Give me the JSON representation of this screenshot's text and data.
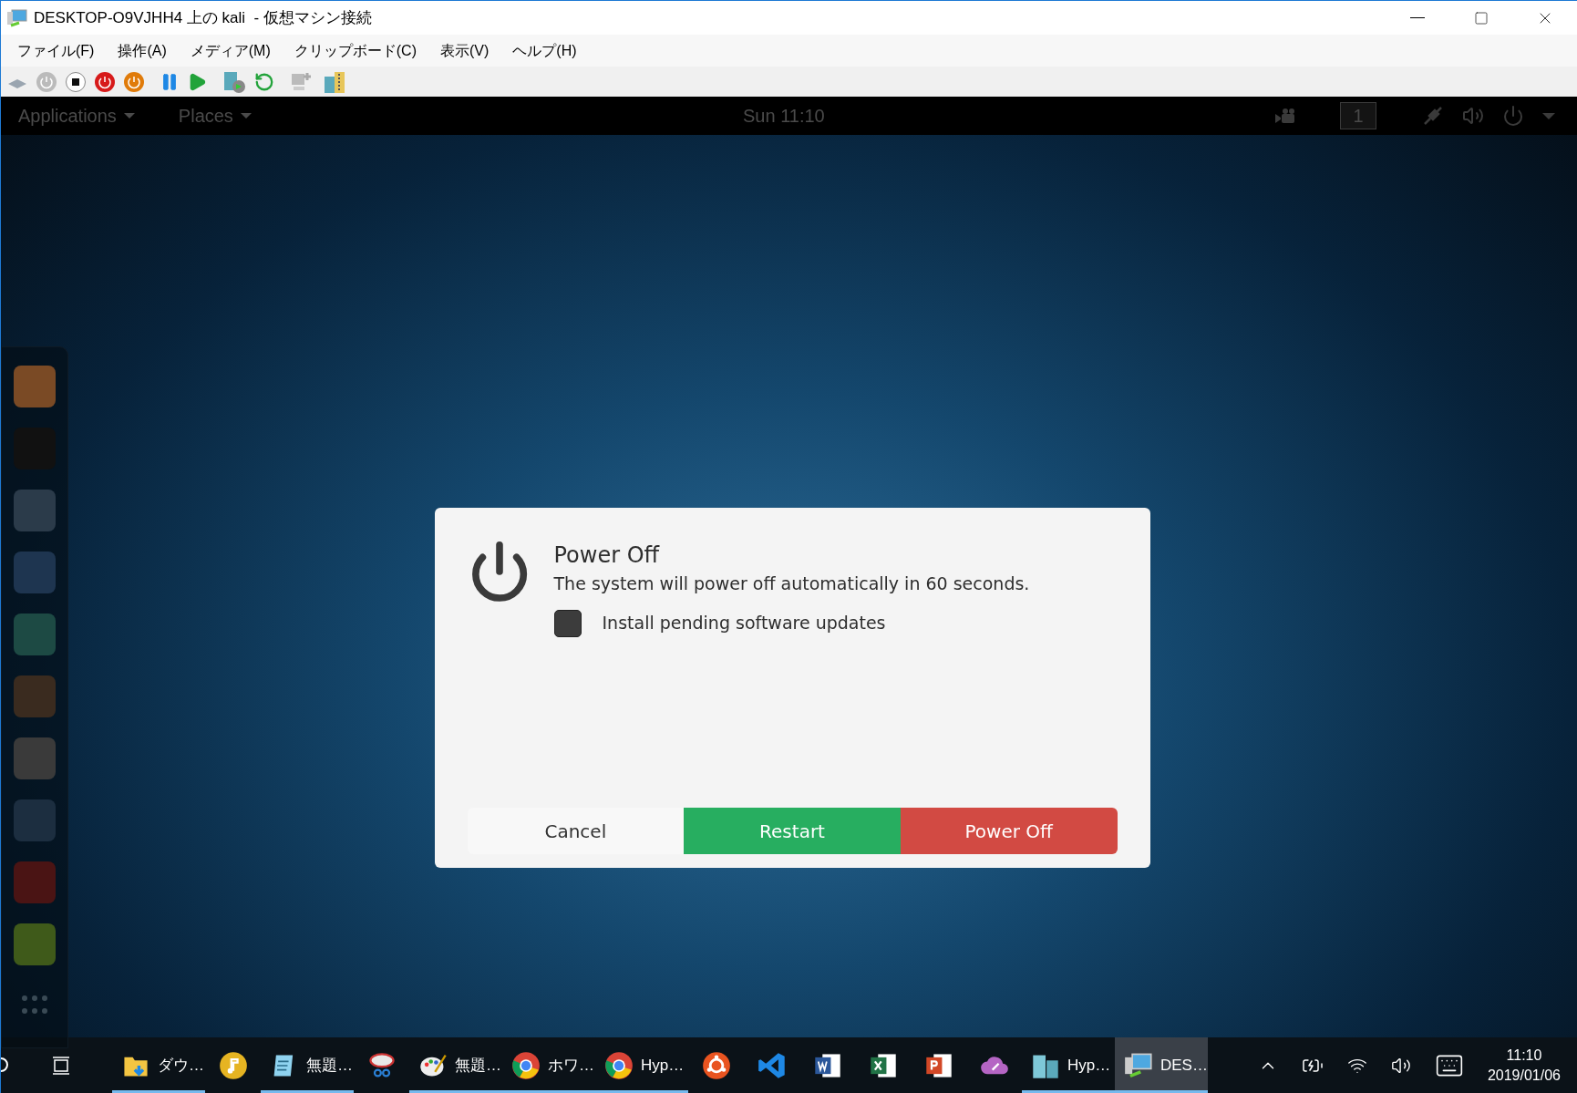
{
  "window": {
    "title": "DESKTOP-O9VJHH4 上の kali  - 仮想マシン接続"
  },
  "menu": [
    "ファイル(F)",
    "操作(A)",
    "メディア(M)",
    "クリップボード(C)",
    "表示(V)",
    "ヘルプ(H)"
  ],
  "top_panel": {
    "applications": "Applications",
    "places": "Places",
    "clock": "Sun 11:10",
    "workspace": "1"
  },
  "dialog": {
    "title": "Power Off",
    "message": "The system will power off automatically in 60 seconds.",
    "checkbox": {
      "label": "Install pending software updates",
      "checked": false
    },
    "buttons": [
      {
        "label": "Cancel",
        "kind": "cancel"
      },
      {
        "label": "Restart",
        "kind": "restart"
      },
      {
        "label": "Power Off",
        "kind": "power"
      }
    ]
  },
  "taskbar": {
    "items": [
      {
        "label": "ダウ…",
        "running": true,
        "selected": false
      },
      {
        "running": false,
        "selected": false
      },
      {
        "label": "無題…",
        "running": true,
        "selected": false
      },
      {
        "running": false,
        "selected": false
      },
      {
        "label": "無題…",
        "running": true,
        "selected": false
      },
      {
        "label": "ホワ…",
        "running": true,
        "selected": false
      },
      {
        "label": "Hyp…",
        "running": true,
        "selected": false
      },
      {
        "running": false,
        "selected": false
      },
      {
        "running": false,
        "selected": false
      },
      {
        "running": false,
        "selected": false
      },
      {
        "running": false,
        "selected": false
      },
      {
        "running": false,
        "selected": false
      },
      {
        "running": false,
        "selected": false
      },
      {
        "label": "Hyp…",
        "running": true,
        "selected": false
      },
      {
        "label": "DES…",
        "running": true,
        "selected": true
      }
    ],
    "time": "11:10",
    "date": "2019/01/06"
  }
}
